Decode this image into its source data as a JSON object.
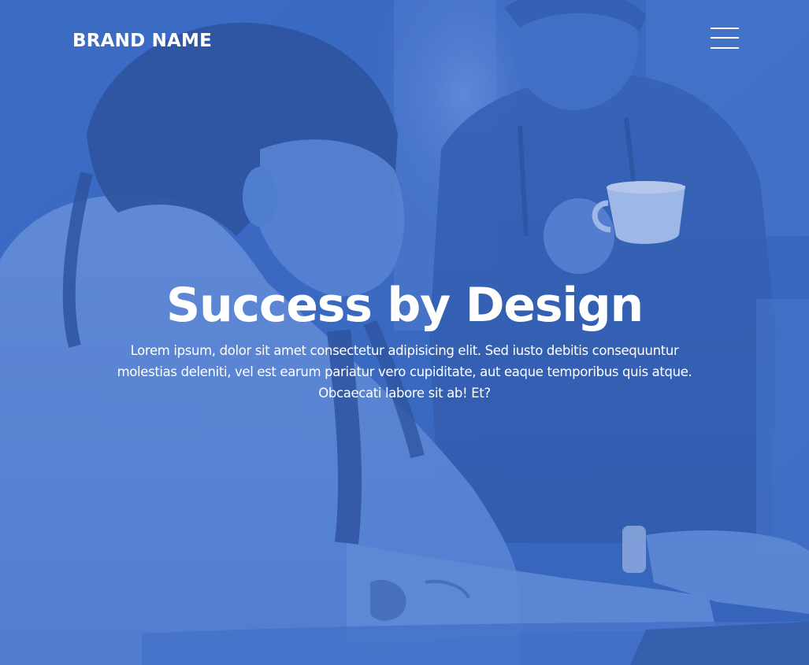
{
  "header": {
    "brand": "BRAND NAME",
    "menu_icon": "hamburger-menu-icon"
  },
  "hero": {
    "title": "Success by Design",
    "text": "Lorem ipsum, dolor sit amet consectetur adipisicing elit. Sed iusto debitis consequuntur molestias deleniti, vel est earum pariatur vero cupiditate, aut eaque temporibus quis atque. Obcaecati labore sit ab! Et?",
    "image": "two-people-working-at-laptop-with-coffee",
    "overlay_color": "#3a6bc4"
  }
}
